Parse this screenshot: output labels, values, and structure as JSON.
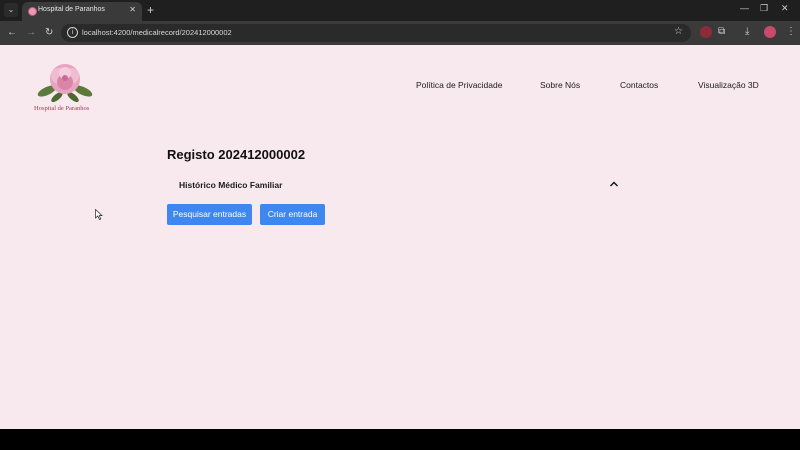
{
  "browser": {
    "tab_title": "Hospital de Paranhos",
    "url": "localhost:4200/medicalrecord/202412000002"
  },
  "site": {
    "logo_text": "Hospital de Paranhos",
    "nav": [
      {
        "label": "Política de Privacidade"
      },
      {
        "label": "Sobre Nós"
      },
      {
        "label": "Contactos"
      },
      {
        "label": "Visualização 3D"
      }
    ]
  },
  "record": {
    "title": "Registo 202412000002",
    "accordion_label": "Histórico Médico Familiar",
    "search_button": "Pesquisar entradas",
    "create_button": "Criar entrada"
  },
  "colors": {
    "page_background": "#f8e9ee",
    "button_primary": "#3f87f0",
    "logo_text": "#a03a57"
  }
}
